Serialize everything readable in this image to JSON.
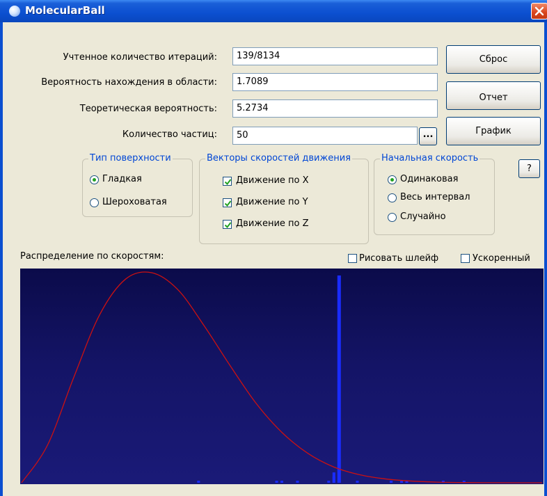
{
  "window": {
    "title": "MolecularBall"
  },
  "fields": {
    "iterations": {
      "label": "Учтенное количество итераций:",
      "value": "139/8134"
    },
    "probability": {
      "label": "Вероятность нахождения в области:",
      "value": "1.7089"
    },
    "theoretical": {
      "label": "Теоретическая вероятность:",
      "value": "5.2734"
    },
    "particles": {
      "label": "Количество частиц:",
      "value": "50",
      "browse_label": "..."
    }
  },
  "buttons": {
    "reset": "Сброс",
    "report": "Отчет",
    "graph": "График",
    "help": "?"
  },
  "surface": {
    "legend": "Тип поверхности",
    "options": [
      "Гладкая",
      "Шероховатая"
    ],
    "selected": "Гладкая"
  },
  "vectors": {
    "legend": "Векторы скоростей движения",
    "options": [
      "Движение по X",
      "Движение по Y",
      "Движение по Z"
    ],
    "checked": [
      true,
      true,
      true
    ]
  },
  "initial_speed": {
    "legend": "Начальная скорость",
    "options": [
      "Одинаковая",
      "Весь интервал",
      "Случайно"
    ],
    "selected": "Одинаковая"
  },
  "distribution": {
    "label": "Распределение по скоростям:",
    "draw_trail": {
      "label": "Рисовать шлейф",
      "checked": false
    },
    "accelerated": {
      "label": "Ускоренный",
      "checked": false
    }
  },
  "colors": {
    "plot_bg": "#141466",
    "curve": "#cc1111",
    "bars": "#1a2cff",
    "legend_text": "#0046d5",
    "radio_dot": "#21a121"
  },
  "chart_data": {
    "type": "bar",
    "series": [
      {
        "kind": "curve",
        "x": [
          0,
          0.05,
          0.1,
          0.15,
          0.2,
          0.25,
          0.3,
          0.35,
          0.4,
          0.45,
          0.5,
          0.55,
          0.6,
          0.65,
          0.7,
          0.75,
          0.8,
          0.85,
          0.9,
          0.95,
          1.0
        ],
        "y": [
          0,
          0.18,
          0.5,
          0.8,
          0.97,
          1.0,
          0.92,
          0.75,
          0.56,
          0.38,
          0.24,
          0.14,
          0.075,
          0.038,
          0.018,
          0.008,
          0.003,
          0.001,
          0.0004,
          0.0001,
          0
        ]
      },
      {
        "kind": "bars",
        "x": [
          0.34,
          0.49,
          0.5,
          0.53,
          0.59,
          0.6,
          0.6,
          0.61,
          0.645,
          0.71,
          0.71,
          0.73,
          0.74,
          0.74,
          0.81,
          0.85
        ],
        "y": [
          0.01,
          0.01,
          0.01,
          0.01,
          0.01,
          0.03,
          0.05,
          1.0,
          0.01,
          0.01,
          0.01,
          0.01,
          0.01,
          0.01,
          0.01,
          0.01
        ]
      }
    ]
  }
}
